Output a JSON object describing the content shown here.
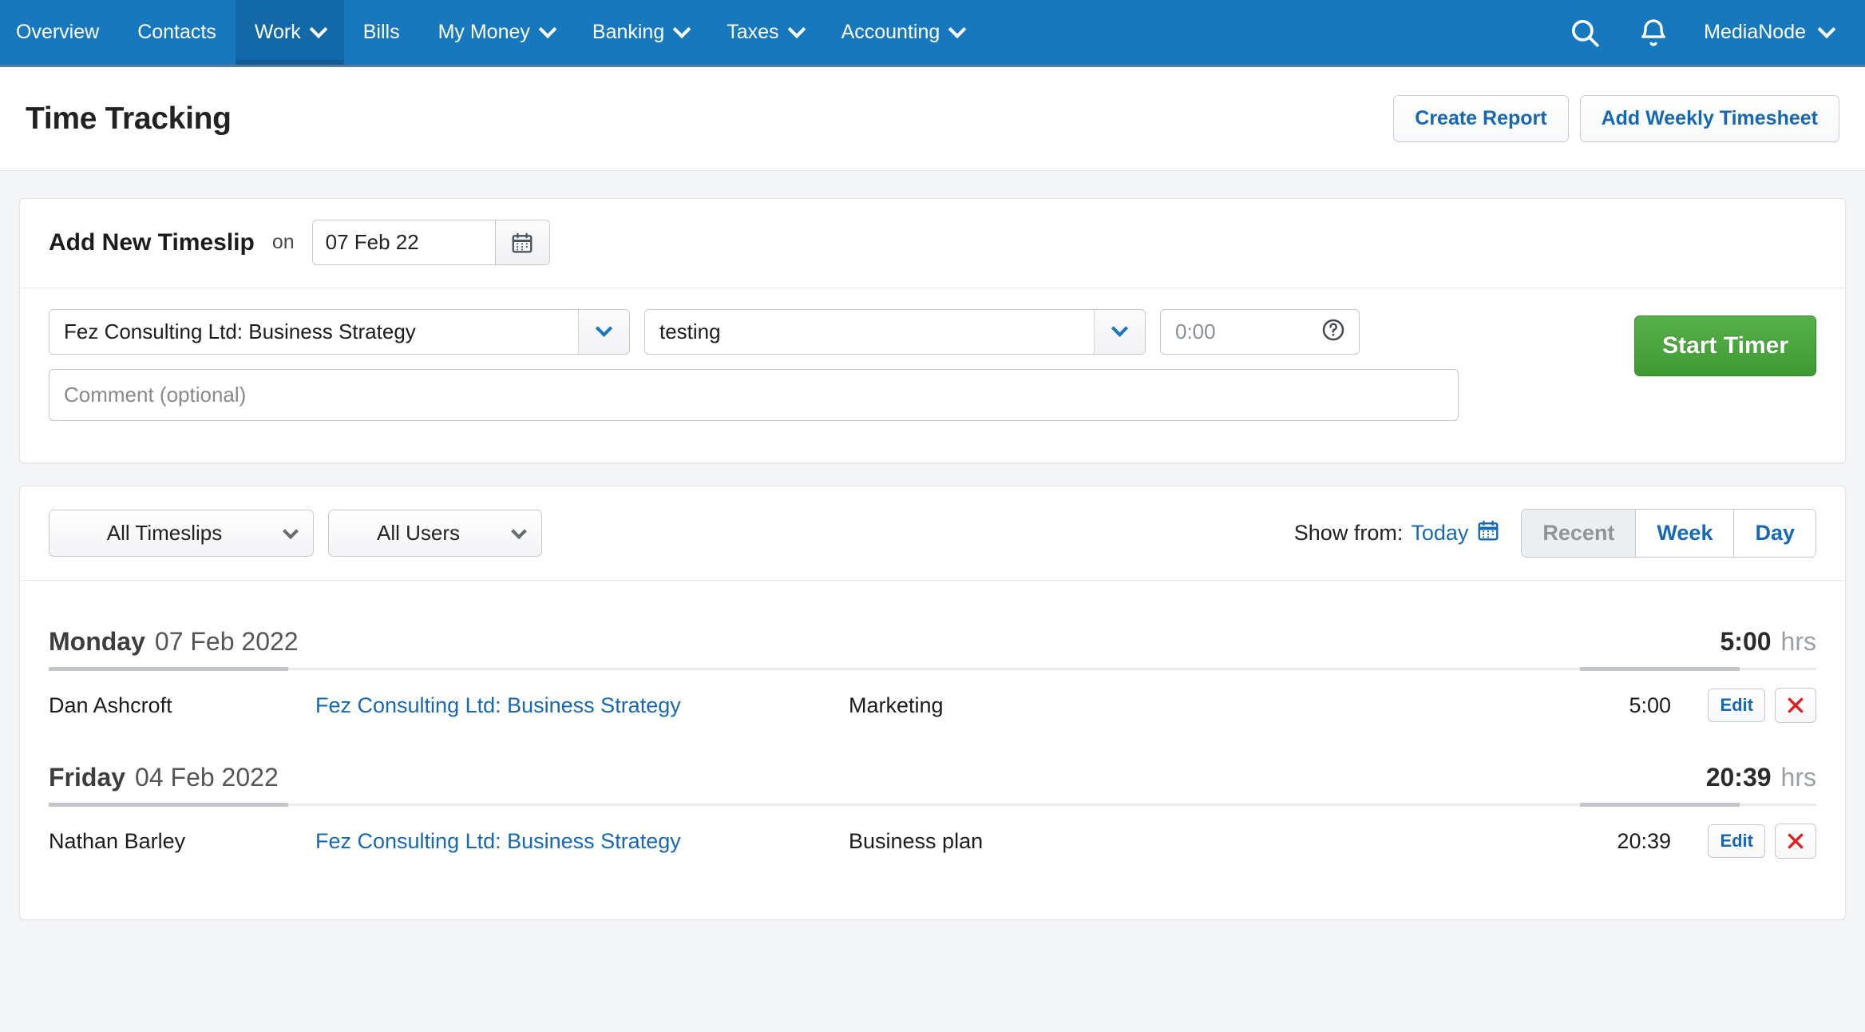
{
  "nav": {
    "items": [
      {
        "label": "Overview",
        "has_caret": false,
        "active": false
      },
      {
        "label": "Contacts",
        "has_caret": false,
        "active": false
      },
      {
        "label": "Work",
        "has_caret": true,
        "active": true
      },
      {
        "label": "Bills",
        "has_caret": false,
        "active": false
      },
      {
        "label": "My Money",
        "has_caret": true,
        "active": false
      },
      {
        "label": "Banking",
        "has_caret": true,
        "active": false
      },
      {
        "label": "Taxes",
        "has_caret": true,
        "active": false
      },
      {
        "label": "Accounting",
        "has_caret": true,
        "active": false
      }
    ],
    "search_icon": "search-icon",
    "bell_icon": "bell-icon",
    "account_label": "MediaNode",
    "brand_color": "#1878bd"
  },
  "header": {
    "title": "Time Tracking",
    "create_report_label": "Create Report",
    "add_weekly_timesheet_label": "Add Weekly Timesheet"
  },
  "timeslip": {
    "title": "Add New Timeslip",
    "on_label": "on",
    "date_value": "07 Feb 22",
    "calendar_icon": "calendar-icon",
    "project_value": "Fez Consulting Ltd: Business Strategy",
    "project_placeholder": "",
    "task_value": "testing",
    "task_placeholder": "",
    "time_placeholder": "0:00",
    "time_value": "",
    "help_icon": "question-circle-icon",
    "comment_placeholder": "Comment (optional)",
    "comment_value": "",
    "start_timer_label": "Start Timer",
    "start_timer_color": "#47a53c"
  },
  "filters": {
    "timeslips_selected": "All Timeslips",
    "users_selected": "All Users",
    "show_from_label": "Show from:",
    "show_from_value": "Today",
    "show_from_icon": "calendar-icon",
    "segments": [
      {
        "label": "Recent",
        "state": "selected"
      },
      {
        "label": "Week",
        "state": "default"
      },
      {
        "label": "Day",
        "state": "default"
      }
    ]
  },
  "list": {
    "hrs_label": "hrs",
    "edit_label": "Edit",
    "delete_icon": "close-x-icon",
    "groups": [
      {
        "day_of_week": "Monday",
        "date": "07 Feb 2022",
        "total": "5:00",
        "rows": [
          {
            "user": "Dan Ashcroft",
            "project": "Fez Consulting Ltd: Business Strategy",
            "task": "Marketing",
            "time": "5:00"
          }
        ]
      },
      {
        "day_of_week": "Friday",
        "date": "04 Feb 2022",
        "total": "20:39",
        "rows": [
          {
            "user": "Nathan Barley",
            "project": "Fez Consulting Ltd: Business Strategy",
            "task": "Business plan",
            "time": "20:39"
          }
        ]
      }
    ]
  }
}
